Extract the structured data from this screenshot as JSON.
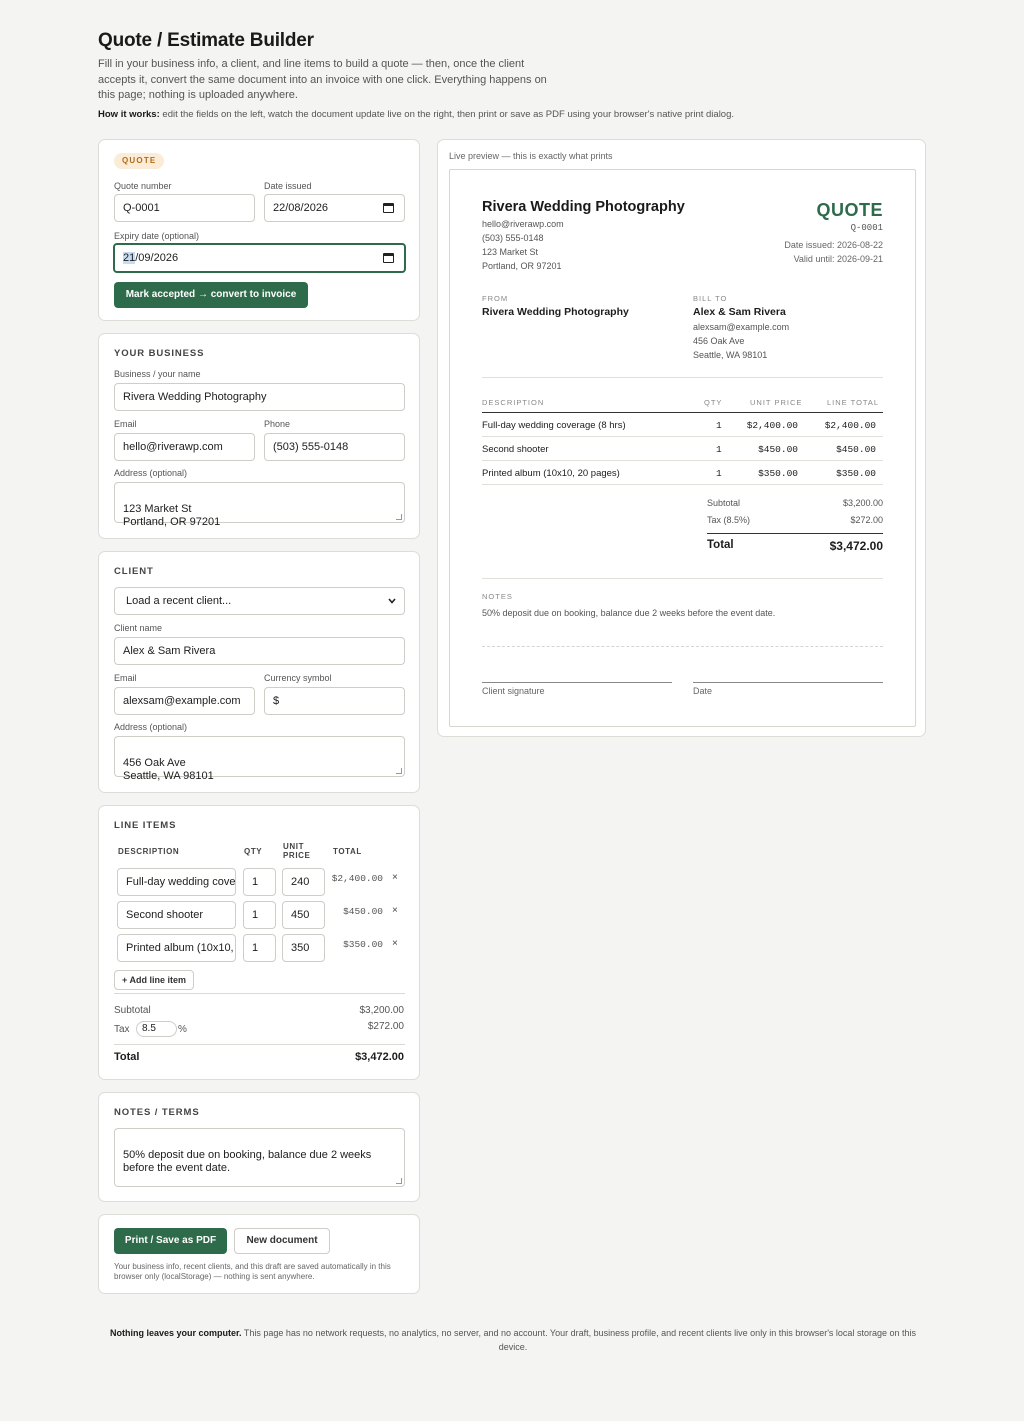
{
  "header": {
    "title": "Quote / Estimate Builder",
    "intro": "Fill in your business info, a client, and line items to build a quote — then, once the client accepts it, convert the same document into an invoice with one click. Everything happens on this page; nothing is uploaded anywhere.",
    "how_label": "How it works:",
    "how_text": " edit the fields on the left, watch the document update live on the right, then print or save as PDF using your browser's native print dialog."
  },
  "quote_card": {
    "badge": "QUOTE",
    "number_label": "Quote number",
    "number_value": "Q-0001",
    "date_label": "Date issued",
    "date_value": "22/08/2026",
    "expiry_label": "Expiry date (optional)",
    "expiry_value_day": "21",
    "expiry_value_rest": "/09/2026",
    "convert_button": "Mark accepted → convert to invoice"
  },
  "business": {
    "title": "YOUR BUSINESS",
    "name_label": "Business / your name",
    "name_value": "Rivera Wedding Photography",
    "email_label": "Email",
    "email_value": "hello@riverawp.com",
    "phone_label": "Phone",
    "phone_value": "(503) 555-0148",
    "address_label": "Address (optional)",
    "address_value": "123 Market St\nPortland, OR 97201"
  },
  "client": {
    "title": "CLIENT",
    "recent_select": "Load a recent client...",
    "name_label": "Client name",
    "name_value": "Alex & Sam Rivera",
    "email_label": "Email",
    "email_value": "alexsam@example.com",
    "currency_label": "Currency symbol",
    "currency_value": "$",
    "address_label": "Address (optional)",
    "address_value": "456 Oak Ave\nSeattle, WA 98101"
  },
  "line_items": {
    "title": "LINE ITEMS",
    "col_description": "DESCRIPTION",
    "col_qty": "QTY",
    "col_unit_price": "UNIT\nPRICE",
    "col_total": "TOTAL",
    "rows": [
      {
        "description": "Full-day wedding cove",
        "qty": "1",
        "price": "240",
        "total": "$2,400.00"
      },
      {
        "description": "Second shooter",
        "qty": "1",
        "price": "450",
        "total": "$450.00"
      },
      {
        "description": "Printed album (10x10,",
        "qty": "1",
        "price": "350",
        "total": "$350.00"
      }
    ],
    "remove_glyph": "×",
    "add_button": "+ Add line item",
    "subtotal_label": "Subtotal",
    "subtotal_value": "$3,200.00",
    "tax_label": "Tax",
    "tax_rate": "8.5",
    "tax_pct": "%",
    "tax_value": "$272.00",
    "total_label": "Total",
    "total_value": "$3,472.00"
  },
  "notes": {
    "title": "NOTES / TERMS",
    "value": "50% deposit due on booking, balance due 2 weeks before the event date."
  },
  "actions": {
    "print_button": "Print / Save as PDF",
    "new_button": "New document",
    "storage_note": "Your business info, recent clients, and this draft are saved automatically in this browser only (localStorage) — nothing is sent anywhere."
  },
  "preview": {
    "caption": "Live preview — this is exactly what prints",
    "business_name": "Rivera Wedding Photography",
    "business_email": "hello@riverawp.com",
    "business_phone": "(503) 555-0148",
    "business_addr1": "123 Market St",
    "business_addr2": "Portland, OR 97201",
    "doc_type": "QUOTE",
    "doc_number": "Q-0001",
    "date_issued": "Date issued: 2026-08-22",
    "valid_until": "Valid until: 2026-09-21",
    "from_label": "FROM",
    "from_name": "Rivera Wedding Photography",
    "bill_to_label": "BILL TO",
    "bill_name": "Alex & Sam Rivera",
    "bill_email": "alexsam@example.com",
    "bill_addr1": "456 Oak Ave",
    "bill_addr2": "Seattle, WA 98101",
    "col_description": "DESCRIPTION",
    "col_qty": "QTY",
    "col_unit_price": "UNIT PRICE",
    "col_line_total": "LINE TOTAL",
    "rows": [
      {
        "description": "Full-day wedding coverage (8 hrs)",
        "qty": "1",
        "price": "$2,400.00",
        "total": "$2,400.00"
      },
      {
        "description": "Second shooter",
        "qty": "1",
        "price": "$450.00",
        "total": "$450.00"
      },
      {
        "description": "Printed album (10x10, 20 pages)",
        "qty": "1",
        "price": "$350.00",
        "total": "$350.00"
      }
    ],
    "subtotal_label": "Subtotal",
    "subtotal_value": "$3,200.00",
    "tax_label": "Tax (8.5%)",
    "tax_value": "$272.00",
    "total_label": "Total",
    "total_value": "$3,472.00",
    "notes_label": "NOTES",
    "notes_text": "50% deposit due on booking, balance due 2 weeks before the event date.",
    "signature_label": "Client signature",
    "date_label": "Date"
  },
  "footer": {
    "bold": "Nothing leaves your computer.",
    "text": " This page has no network requests, no analytics, no server, and no account. Your draft, business profile, and recent clients live only in this browser's local storage on this device."
  },
  "colors": {
    "accent": "#2e6b4b",
    "badge_bg": "#fbecd7",
    "badge_text": "#b26b1a",
    "page_bg": "#f4f4f2"
  }
}
